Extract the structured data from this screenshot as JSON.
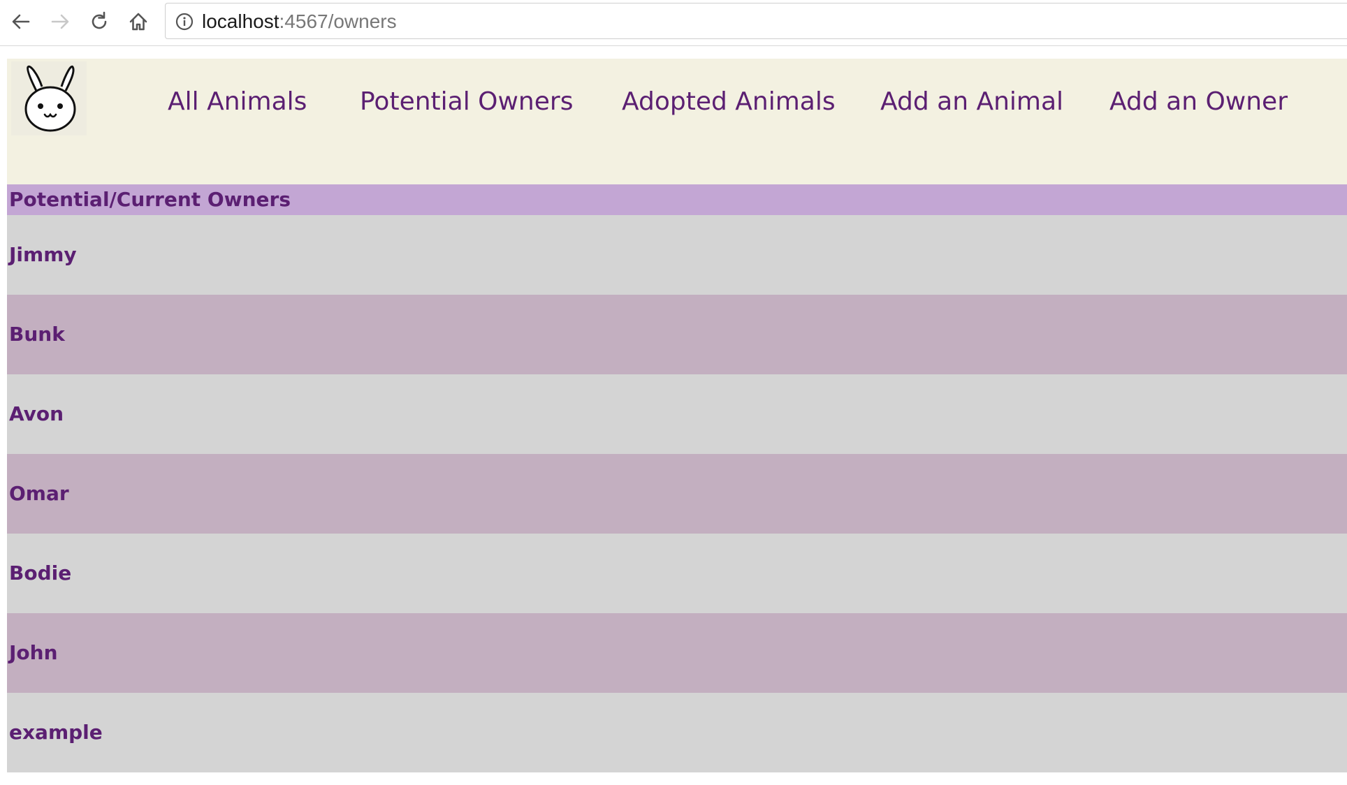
{
  "browser": {
    "url_host": "localhost",
    "url_path": ":4567/owners"
  },
  "nav": {
    "items": [
      {
        "label": "All Animals"
      },
      {
        "label": "Potential Owners"
      },
      {
        "label": "Adopted Animals"
      },
      {
        "label": "Add an Animal"
      },
      {
        "label": "Add an Owner"
      }
    ]
  },
  "section": {
    "title": "Potential/Current Owners"
  },
  "owners": [
    {
      "name": "Jimmy"
    },
    {
      "name": "Bunk"
    },
    {
      "name": "Avon"
    },
    {
      "name": "Omar"
    },
    {
      "name": "Bodie"
    },
    {
      "name": "John"
    },
    {
      "name": "example"
    }
  ],
  "colors": {
    "header_bg": "#f3f1e1",
    "link": "#5b1f72",
    "title_bar": "#c3a6d4",
    "row_light": "#d4d4d4",
    "row_dark": "#c3afc0"
  }
}
